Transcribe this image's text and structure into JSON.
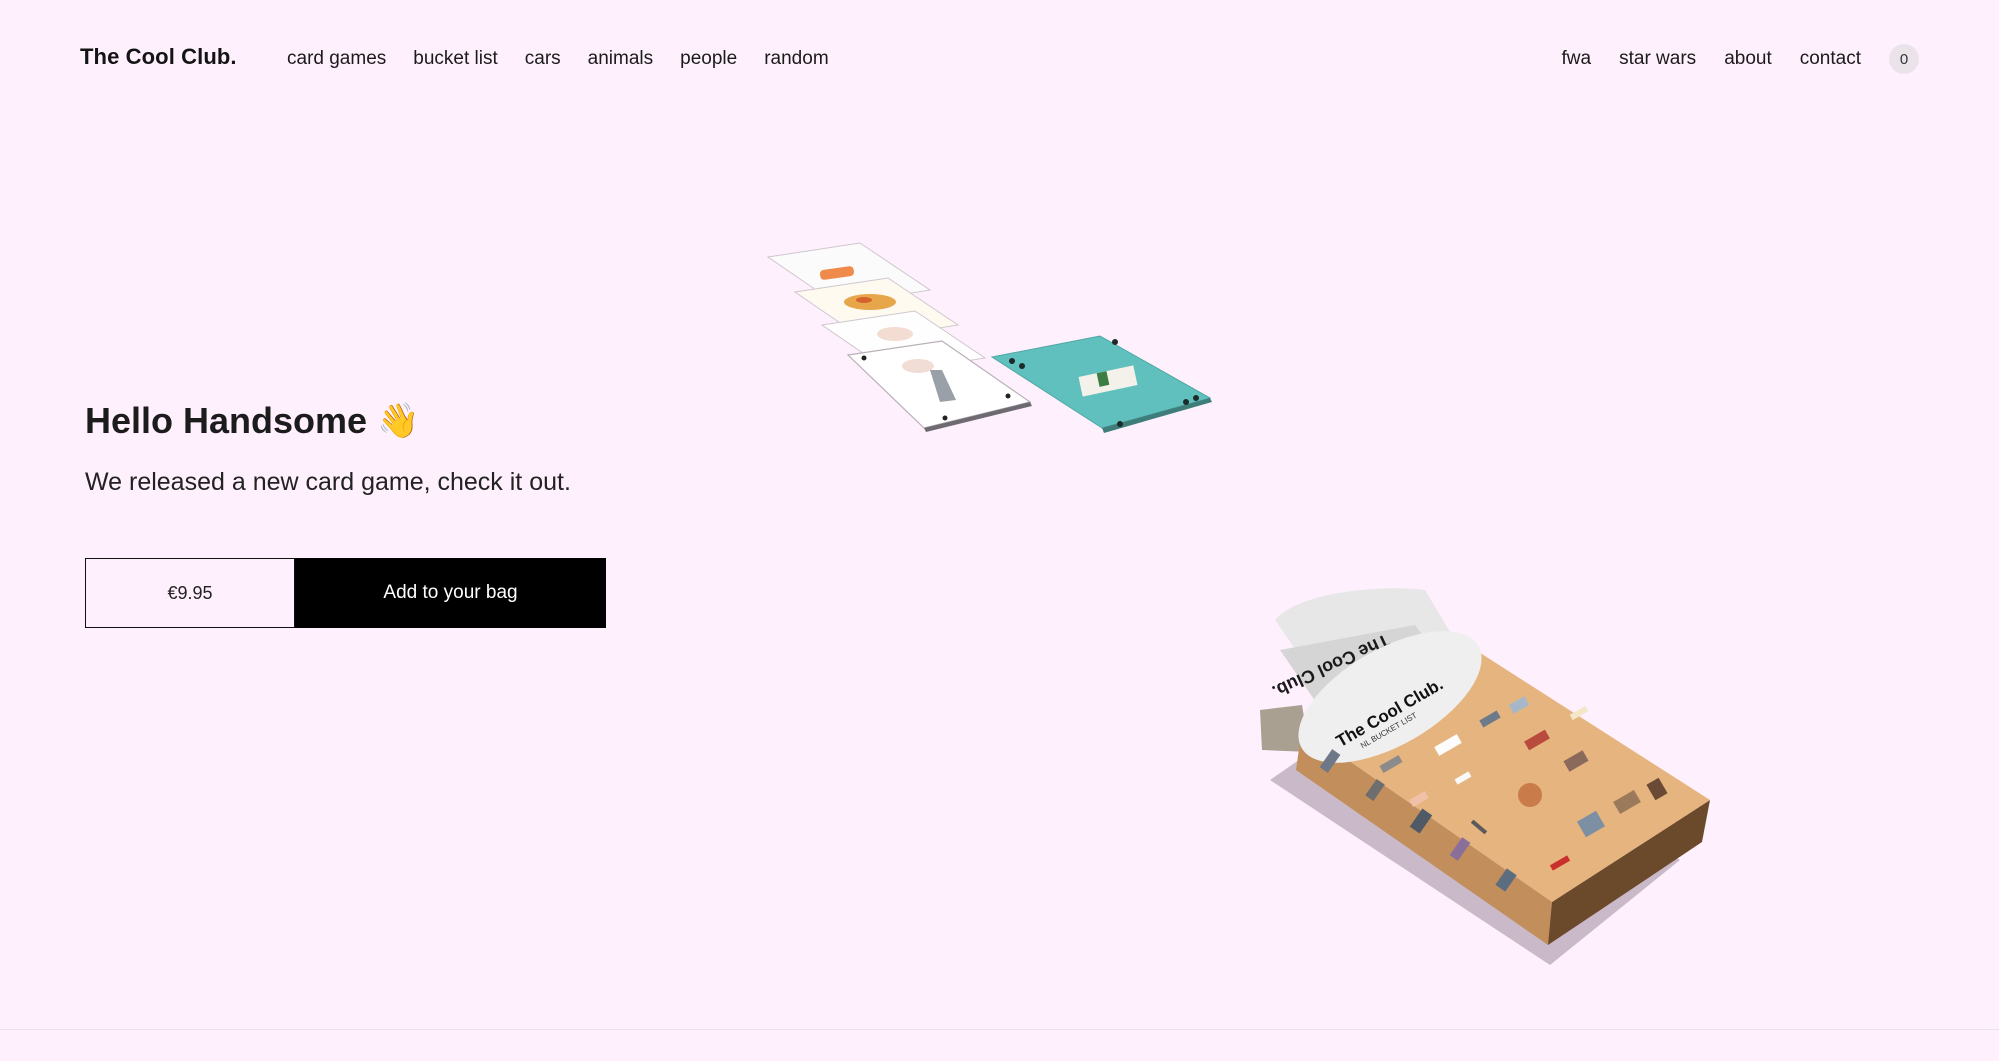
{
  "header": {
    "logo": "The Cool Club.",
    "nav_left": [
      "card games",
      "bucket list",
      "cars",
      "animals",
      "people",
      "random"
    ],
    "nav_right": [
      "fwa",
      "star wars",
      "about",
      "contact"
    ],
    "bag_count": "0"
  },
  "hero": {
    "title": "Hello Handsome",
    "wave_emoji": "👋",
    "subtitle": "We released a new card game, check it out.",
    "price": "€9.95",
    "add_button": "Add to your bag"
  },
  "box_art": {
    "brand": "The Cool Club.",
    "flap_text": "The Cool Club.",
    "edition": "NL BUCKET LIST"
  },
  "colors": {
    "background": "#fff0fd",
    "button_bg": "#000000",
    "card_teal": "#5fc0bd",
    "box_tan": "#e6b47f"
  }
}
